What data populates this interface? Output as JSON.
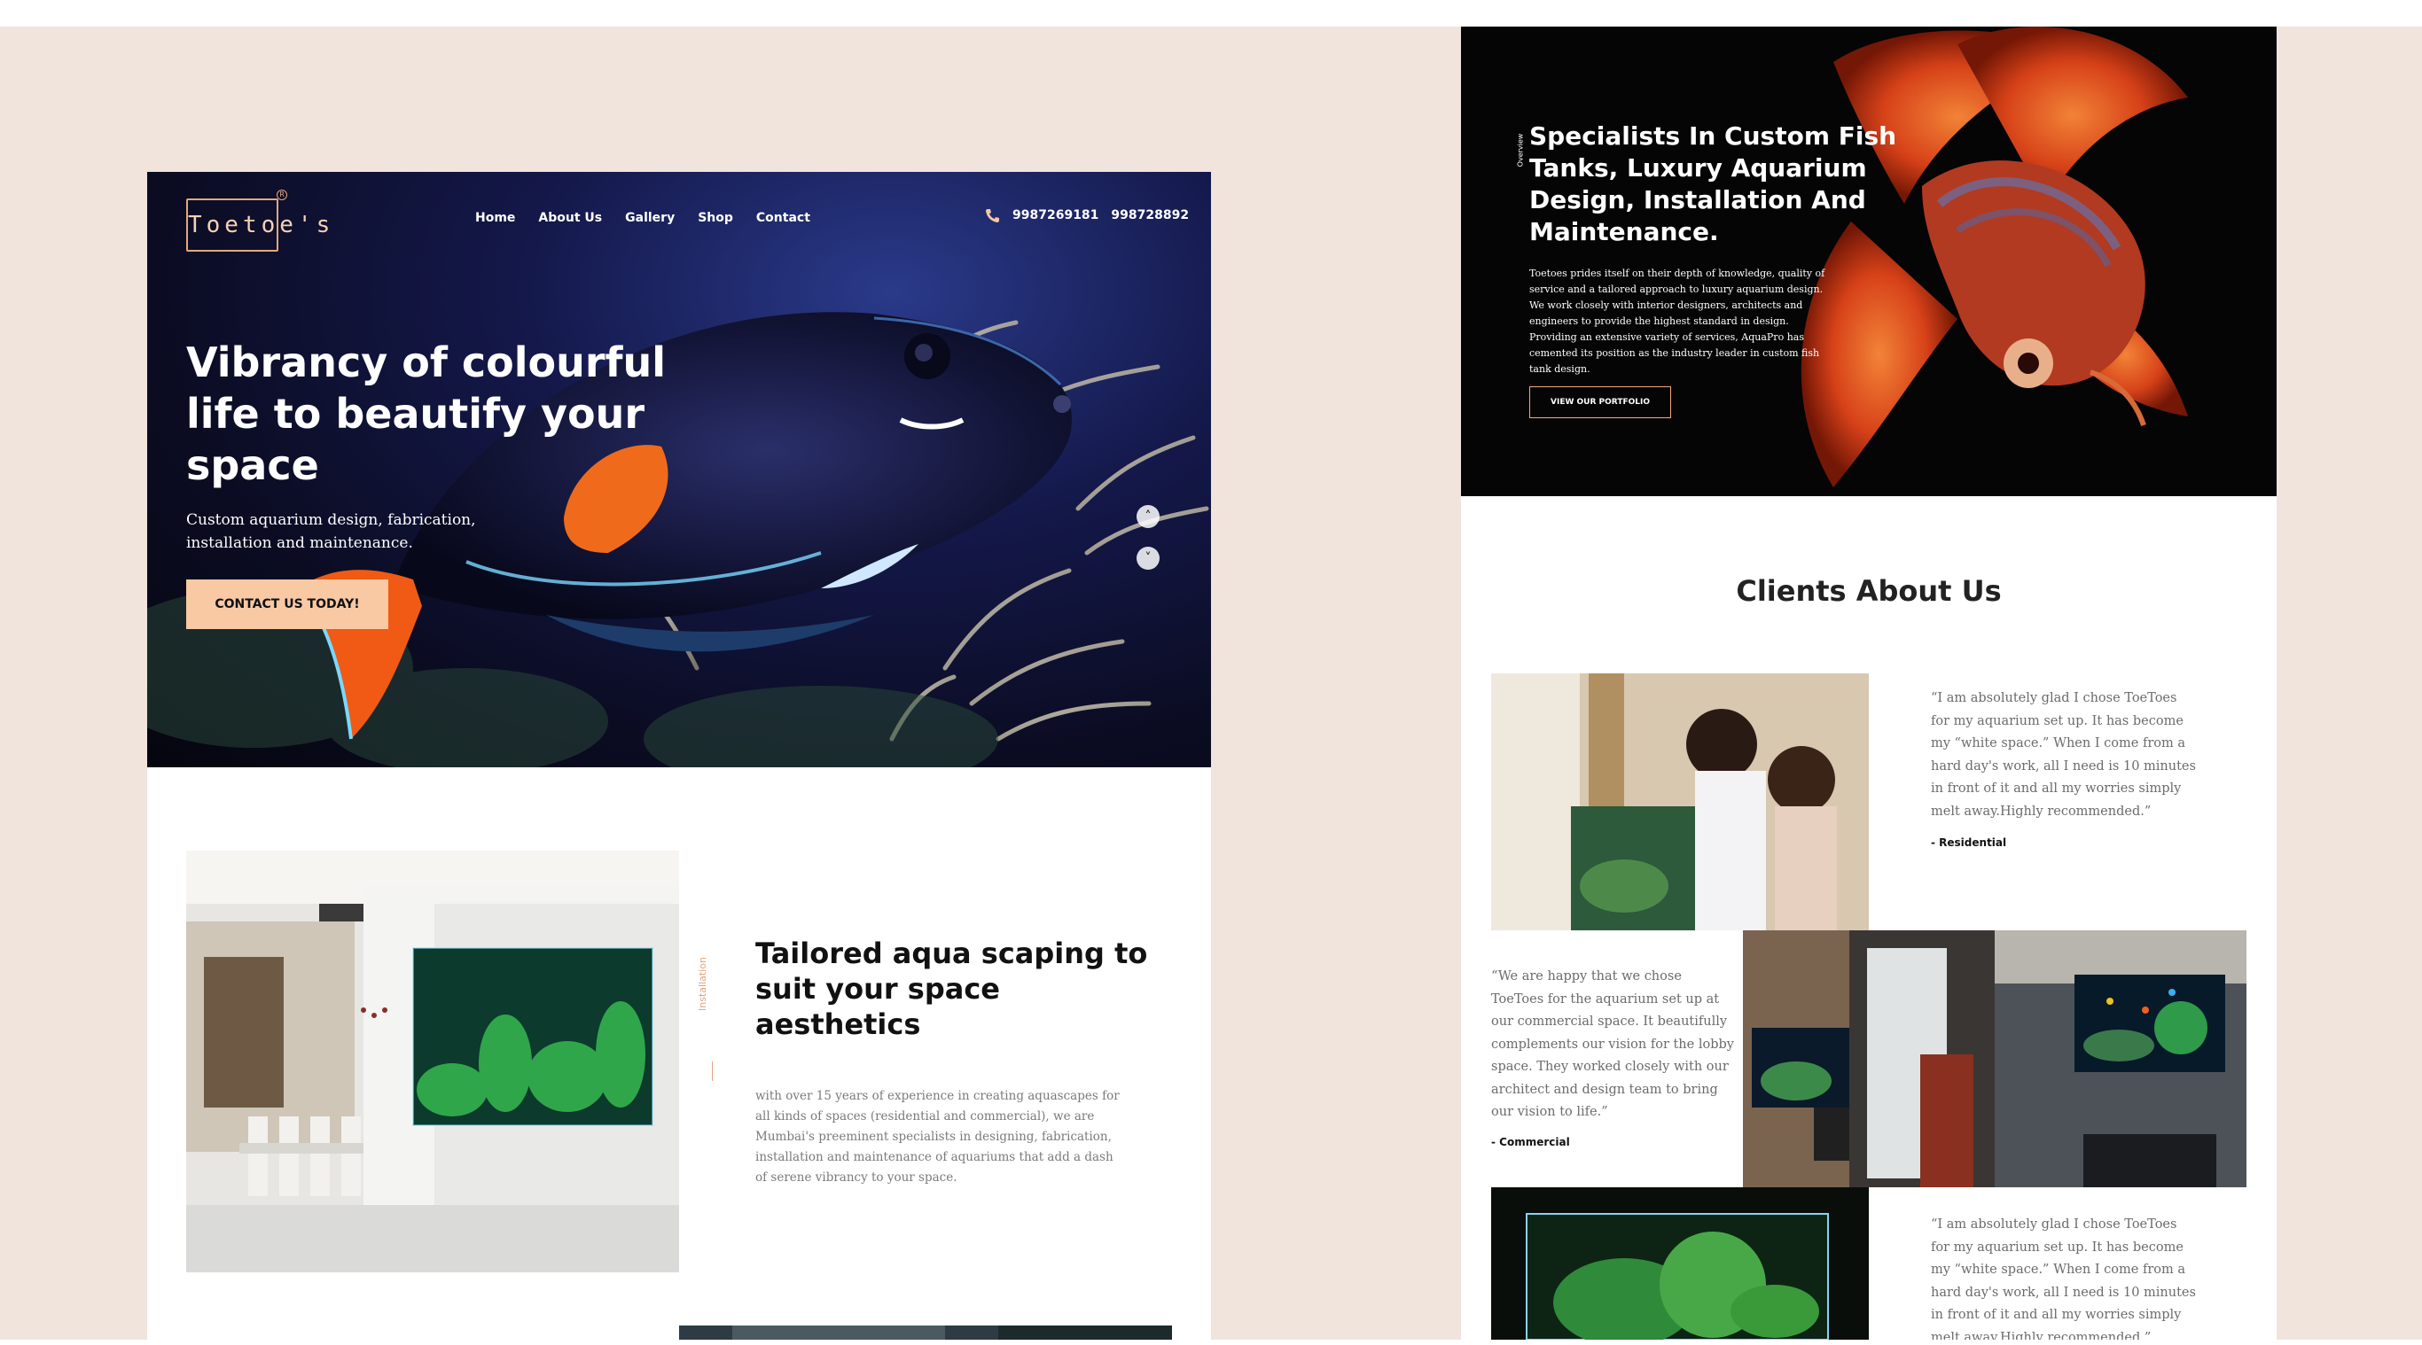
{
  "left_page": {
    "logo": {
      "text": "Toetoe's",
      "reg": "R"
    },
    "nav": [
      "Home",
      "About Us",
      "Gallery",
      "Shop",
      "Contact"
    ],
    "phones": [
      "9987269181",
      "998728892"
    ],
    "hero": {
      "title": "Vibrancy of colourful life to beautify your space",
      "subtitle": "Custom aquarium design, fabrication, installation and maintenance.",
      "cta": "CONTACT US TODAY!"
    },
    "section": {
      "side_label": "Installation",
      "title": "Tailored aqua scaping to suit your space aesthetics",
      "body": "with over 15 years of experience in creating aquascapes for all kinds of spaces (residential and commercial), we are Mumbai's preeminent specialists in designing, fabrication, installation and maintenance of aquariums that add a dash of serene vibrancy to your space."
    }
  },
  "right_page": {
    "hero": {
      "vertical_tab": "Overview",
      "title": "Specialists In Custom Fish Tanks, Luxury Aquarium Design, Installation And Maintenance.",
      "body": "Toetoes prides itself on their depth of knowledge, quality of service and a tailored approach to luxury aquarium design. We work closely with interior designers, architects and engineers to provide the highest standard in design. Providing an extensive variety of services, AquaPro has cemented its position as the industry leader in custom fish tank design.",
      "button": "VIEW OUR PORTFOLIO"
    },
    "clients_title": "Clients About Us",
    "testimonials": [
      {
        "quote": "“I am absolutely glad I chose ToeToes for my aquarium set up. It has become my “white space.” When I come from a hard day's work, all I need is 10 minutes in front of it and all my worries simply melt away.Highly recommended.”",
        "author": "- Residential"
      },
      {
        "quote": "“We are happy that we chose ToeToes for the aquarium set up at our commercial space. It beautifully complements our vision for the lobby space. They worked closely with our architect and design team to bring our vision to life.”",
        "author": "- Commercial"
      },
      {
        "quote": "“I am absolutely glad I chose ToeToes for my aquarium set up. It has become my “white space.” When I come from a hard day's work, all I need is 10 minutes in front of it and all my worries simply melt away.Highly recommended.”",
        "author": ""
      }
    ]
  },
  "colors": {
    "accent": "#f9c9a4",
    "background": "#f0e4dc",
    "outline": "#f4a97a"
  }
}
